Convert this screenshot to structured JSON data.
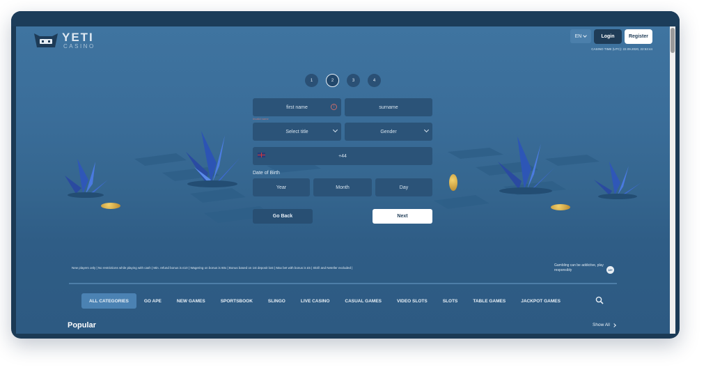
{
  "header": {
    "logo_text": "YETI",
    "logo_sub": "CASINO",
    "language": "EN",
    "login_label": "Login",
    "register_label": "Register",
    "casino_time": "CASINO TIME (UTC): 22.09.2020, 22:53:44"
  },
  "steps": [
    {
      "label": "1",
      "active": false
    },
    {
      "label": "2",
      "active": true
    },
    {
      "label": "3",
      "active": false
    },
    {
      "label": "4",
      "active": false
    }
  ],
  "form": {
    "first_name_placeholder": "first name",
    "surname_placeholder": "surname",
    "first_name_error": "Invalid name",
    "title_select": "Select title",
    "gender_select": "Gender",
    "phone_prefix": "+44",
    "dob_label": "Date of Birth",
    "year_placeholder": "Year",
    "month_placeholder": "Month",
    "day_placeholder": "Day",
    "back_label": "Go Back",
    "next_label": "Next"
  },
  "promo_text": "New players only | No restrictions while playing with cash | Min. refund bonus is £10 | Wagering on bonus is 60x | Bonus based on 1st deposit lost | Max bet with bonus is £5 | Skrill and Neteller excluded |",
  "gambling_notice": "Gambling can be addictive, play responsibly",
  "age_badge": "18+",
  "categories": [
    {
      "label": "ALL CATEGORIES",
      "active": true
    },
    {
      "label": "GO APE",
      "active": false
    },
    {
      "label": "NEW GAMES",
      "active": false
    },
    {
      "label": "SPORTSBOOK",
      "active": false
    },
    {
      "label": "SLINGO",
      "active": false
    },
    {
      "label": "LIVE CASINO",
      "active": false
    },
    {
      "label": "CASUAL GAMES",
      "active": false
    },
    {
      "label": "VIDEO SLOTS",
      "active": false
    },
    {
      "label": "SLOTS",
      "active": false
    },
    {
      "label": "TABLE GAMES",
      "active": false
    },
    {
      "label": "JACKPOT GAMES",
      "active": false
    }
  ],
  "popular_heading": "Popular",
  "show_all_label": "Show All",
  "icons": {
    "search": "search-icon",
    "chevron": "chevron-down-icon",
    "alert": "alert-icon",
    "flag": "uk-flag-icon"
  },
  "colors": {
    "background": "#3a6d99",
    "field": "#2b5378",
    "dark_button": "#1f3c57",
    "active_category": "#4b82b3"
  }
}
